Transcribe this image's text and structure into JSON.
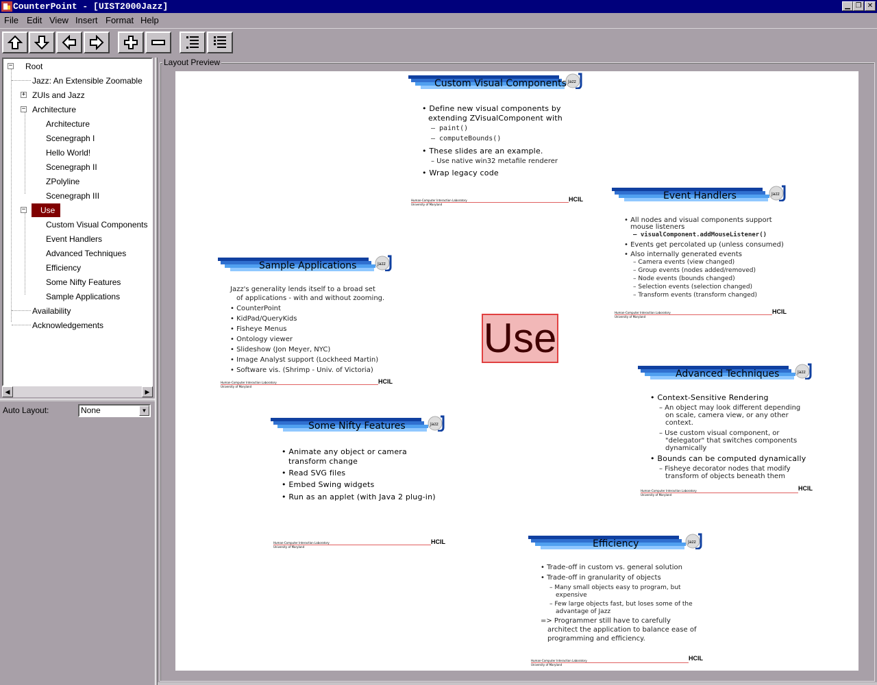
{
  "window": {
    "title": "CounterPoint - [UIST2000Jazz]"
  },
  "menu": [
    "File",
    "Edit",
    "View",
    "Insert",
    "Format",
    "Help"
  ],
  "toolbar_icons": [
    "arrow-up-icon",
    "arrow-down-icon",
    "arrow-left-icon",
    "arrow-right-icon",
    "plus-icon",
    "minus-icon",
    "list-indent-icon",
    "list-outdent-icon"
  ],
  "tree": {
    "items": [
      {
        "label": "Root"
      },
      {
        "label": "Jazz: An Extensible Zoomable"
      },
      {
        "label": "ZUIs and Jazz"
      },
      {
        "label": "Architecture"
      },
      {
        "label": "Architecture"
      },
      {
        "label": "Scenegraph I"
      },
      {
        "label": "Hello World!"
      },
      {
        "label": "Scenegraph II"
      },
      {
        "label": "ZPolyline"
      },
      {
        "label": "Scenegraph III"
      },
      {
        "label": "Use"
      },
      {
        "label": "Custom Visual Components"
      },
      {
        "label": "Event Handlers"
      },
      {
        "label": "Advanced Techniques"
      },
      {
        "label": "Efficiency"
      },
      {
        "label": "Some Nifty Features"
      },
      {
        "label": "Sample Applications"
      },
      {
        "label": "Availability"
      },
      {
        "label": "Acknowledgements"
      }
    ],
    "selected": "Use"
  },
  "auto_layout": {
    "label": "Auto Layout:",
    "value": "None"
  },
  "layout_preview": {
    "label": "Layout Preview",
    "center_label": "Use"
  },
  "slides": {
    "footer_line1": "Human-Computer Interaction Laboratory",
    "footer_line2": "University of Maryland",
    "logo_text": "HCIL",
    "jazz_text": "Jazz",
    "custom": {
      "title": "Custom Visual Components",
      "b1": "Define new visual components by",
      "b1b": "extending ZVisualComponent with",
      "s1": "– paint()",
      "s2": "– computeBounds()",
      "b2": "These slides are an example.",
      "s3": "– Use native win32 metafile renderer",
      "b3": "Wrap legacy code"
    },
    "event": {
      "title": "Event Handlers",
      "b1": "All nodes and visual components support",
      "b1b": "mouse listeners",
      "s1": "– visualComponent.addMouseListener()",
      "b2": "Events get percolated up (unless consumed)",
      "b3": "Also internally generated events",
      "s2": "– Camera events (view changed)",
      "s3": "– Group events (nodes added/removed)",
      "s4": "– Node events (bounds changed)",
      "s5": "– Selection events (selection changed)",
      "s6": "– Transform events (transform changed)"
    },
    "sample": {
      "title": "Sample Applications",
      "intro1": "Jazz's generality lends itself to a broad set",
      "intro2": "of applications - with and without zooming.",
      "b1": "CounterPoint",
      "b2": "KidPad/QueryKids",
      "b3": "Fisheye Menus",
      "b4": "Ontology viewer",
      "b5": "Slideshow (Jon Meyer, NYC)",
      "b6": "Image Analyst support (Lockheed Martin)",
      "b7": "Software vis. (Shrimp - Univ. of Victoria)"
    },
    "advanced": {
      "title": "Advanced Techniques",
      "b1": "Context-Sensitive Rendering",
      "s1": "– An object may look different depending",
      "s1b": "on scale, camera view, or any other",
      "s1c": "context.",
      "s2": "– Use custom visual component, or",
      "s2b": "\"delegator\" that switches components",
      "s2c": "dynamically",
      "b2": "Bounds can be computed dynamically",
      "s3": "– Fisheye decorator nodes that modify",
      "s3b": "transform of objects beneath them"
    },
    "nifty": {
      "title": "Some Nifty Features",
      "b1": "Animate any object or camera",
      "b1b": "transform change",
      "b2": "Read SVG files",
      "b3": "Embed Swing widgets",
      "b4": "Run as an applet (with Java 2 plug-in)"
    },
    "efficiency": {
      "title": "Efficiency",
      "b1": "Trade-off in custom vs. general solution",
      "b2": "Trade-off in granularity of objects",
      "s1": "– Many small objects easy to program, but",
      "s1b": "expensive",
      "s2": "– Few large objects fast, but loses some of the",
      "s2b": "advantage of Jazz",
      "c1": "=> Programmer still have to carefully",
      "c1b": "architect the application to balance ease of",
      "c1c": "programming and efficiency."
    }
  },
  "colors": {
    "title_bar": "#00007b",
    "selection": "#800000",
    "banner_dark": "#1040a0",
    "banner_light": "#50a0f0",
    "use_fill": "#f2b8b8",
    "use_border": "#e04040"
  }
}
